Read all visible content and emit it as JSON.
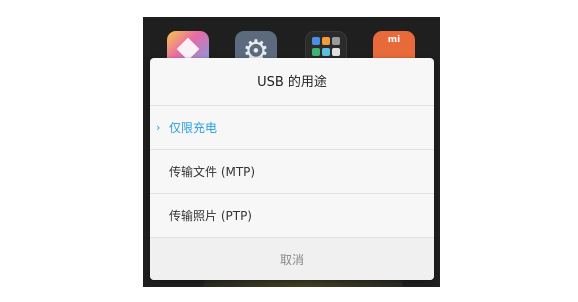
{
  "home_screen": {
    "apps": [
      {
        "icon": "theme-app-icon"
      },
      {
        "icon": "settings-app-icon"
      },
      {
        "icon": "app-folder-icon"
      },
      {
        "icon": "mi-store-app-icon",
        "label": "mi"
      }
    ]
  },
  "dialog": {
    "title": "USB 的用途",
    "options": [
      {
        "label": "仅限充电",
        "selected": true
      },
      {
        "label": "传输文件 (MTP)",
        "selected": false
      },
      {
        "label": "传输照片 (PTP)",
        "selected": false
      }
    ],
    "check_glyph": "›",
    "cancel_label": "取消"
  },
  "colors": {
    "accent": "#2a9fe0",
    "dialog_background": "#f7f7f7",
    "screen_background": "#1f1f1f"
  }
}
